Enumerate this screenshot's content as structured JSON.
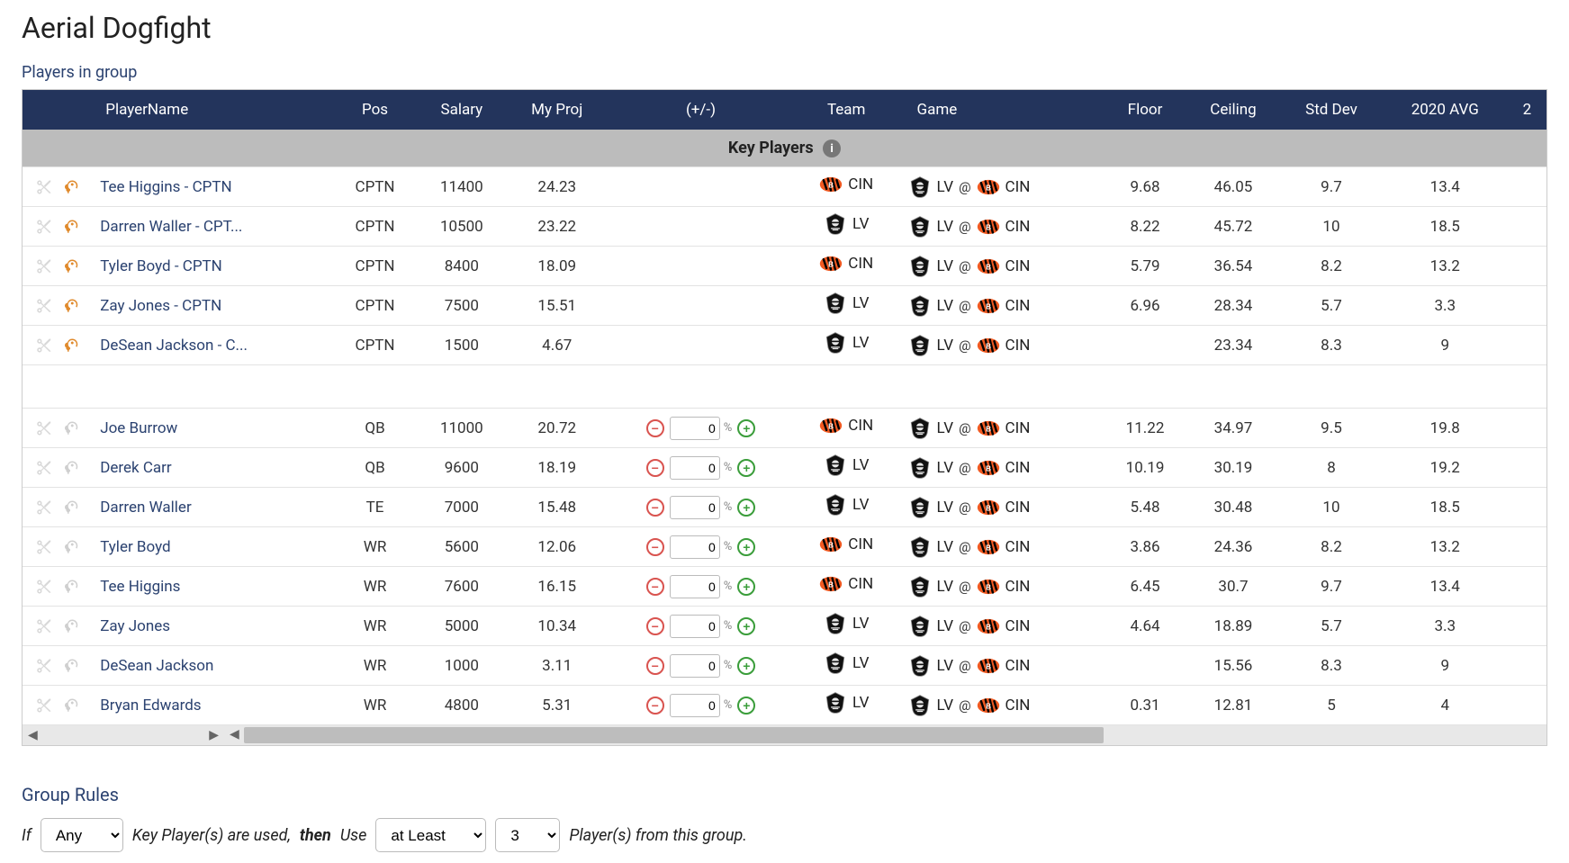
{
  "title": "Aerial Dogfight",
  "sections": {
    "players_title": "Players in group",
    "key_players_label": "Key Players",
    "rules_title": "Group Rules"
  },
  "columns": [
    "PlayerName",
    "Pos",
    "Salary",
    "My Proj",
    "(+/-)",
    "Team",
    "Game",
    "Floor",
    "Ceiling",
    "Std Dev",
    "2020 AVG",
    "2"
  ],
  "game": {
    "away_abbr": "LV",
    "home_abbr": "CIN",
    "at": "@"
  },
  "key_players": [
    {
      "name": "Tee Higgins - CPTN",
      "pos": "CPTN",
      "salary": "11400",
      "proj": "24.23",
      "team": "CIN",
      "floor": "9.68",
      "ceiling": "46.05",
      "stddev": "9.7",
      "avg": "13.4"
    },
    {
      "name": "Darren Waller - CPT...",
      "pos": "CPTN",
      "salary": "10500",
      "proj": "23.22",
      "team": "LV",
      "floor": "8.22",
      "ceiling": "45.72",
      "stddev": "10",
      "avg": "18.5"
    },
    {
      "name": "Tyler Boyd - CPTN",
      "pos": "CPTN",
      "salary": "8400",
      "proj": "18.09",
      "team": "CIN",
      "floor": "5.79",
      "ceiling": "36.54",
      "stddev": "8.2",
      "avg": "13.2"
    },
    {
      "name": "Zay Jones - CPTN",
      "pos": "CPTN",
      "salary": "7500",
      "proj": "15.51",
      "team": "LV",
      "floor": "6.96",
      "ceiling": "28.34",
      "stddev": "5.7",
      "avg": "3.3"
    },
    {
      "name": "DeSean Jackson - C...",
      "pos": "CPTN",
      "salary": "1500",
      "proj": "4.67",
      "team": "LV",
      "floor": "",
      "ceiling": "23.34",
      "stddev": "8.3",
      "avg": "9"
    }
  ],
  "players": [
    {
      "name": "Joe Burrow",
      "pos": "QB",
      "salary": "11000",
      "proj": "20.72",
      "adj": "0",
      "team": "CIN",
      "floor": "11.22",
      "ceiling": "34.97",
      "stddev": "9.5",
      "avg": "19.8"
    },
    {
      "name": "Derek Carr",
      "pos": "QB",
      "salary": "9600",
      "proj": "18.19",
      "adj": "0",
      "team": "LV",
      "floor": "10.19",
      "ceiling": "30.19",
      "stddev": "8",
      "avg": "19.2"
    },
    {
      "name": "Darren Waller",
      "pos": "TE",
      "salary": "7000",
      "proj": "15.48",
      "adj": "0",
      "team": "LV",
      "floor": "5.48",
      "ceiling": "30.48",
      "stddev": "10",
      "avg": "18.5"
    },
    {
      "name": "Tyler Boyd",
      "pos": "WR",
      "salary": "5600",
      "proj": "12.06",
      "adj": "0",
      "team": "CIN",
      "floor": "3.86",
      "ceiling": "24.36",
      "stddev": "8.2",
      "avg": "13.2"
    },
    {
      "name": "Tee Higgins",
      "pos": "WR",
      "salary": "7600",
      "proj": "16.15",
      "adj": "0",
      "team": "CIN",
      "floor": "6.45",
      "ceiling": "30.7",
      "stddev": "9.7",
      "avg": "13.4"
    },
    {
      "name": "Zay Jones",
      "pos": "WR",
      "salary": "5000",
      "proj": "10.34",
      "adj": "0",
      "team": "LV",
      "floor": "4.64",
      "ceiling": "18.89",
      "stddev": "5.7",
      "avg": "3.3"
    },
    {
      "name": "DeSean Jackson",
      "pos": "WR",
      "salary": "1000",
      "proj": "3.11",
      "adj": "0",
      "team": "LV",
      "floor": "",
      "ceiling": "15.56",
      "stddev": "8.3",
      "avg": "9"
    },
    {
      "name": "Bryan Edwards",
      "pos": "WR",
      "salary": "4800",
      "proj": "5.31",
      "adj": "0",
      "team": "LV",
      "floor": "0.31",
      "ceiling": "12.81",
      "stddev": "5",
      "avg": "4"
    }
  ],
  "rules": {
    "if_label": "If",
    "any_option": "Any",
    "key_players_text": "Key Player(s) are used,",
    "then_label": "then",
    "use_label": "Use",
    "atleast_option": "at Least",
    "count_option": "3",
    "players_text": "Player(s) from this group."
  },
  "pct_symbol": "%"
}
